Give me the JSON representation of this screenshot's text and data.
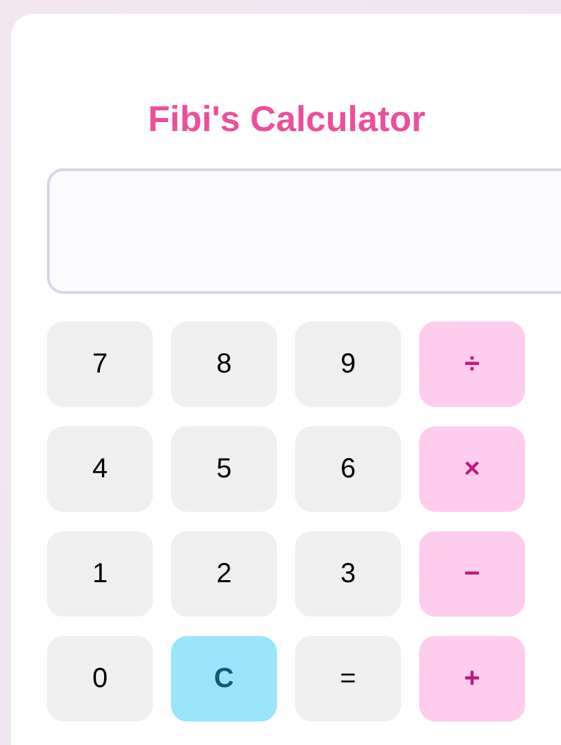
{
  "title": "Fibi's Calculator",
  "buttons": [
    {
      "label": "7",
      "kind": "digit"
    },
    {
      "label": "8",
      "kind": "digit"
    },
    {
      "label": "9",
      "kind": "digit"
    },
    {
      "label": "÷",
      "kind": "operator"
    },
    {
      "label": "4",
      "kind": "digit"
    },
    {
      "label": "5",
      "kind": "digit"
    },
    {
      "label": "6",
      "kind": "digit"
    },
    {
      "label": "×",
      "kind": "operator"
    },
    {
      "label": "1",
      "kind": "digit"
    },
    {
      "label": "2",
      "kind": "digit"
    },
    {
      "label": "3",
      "kind": "digit"
    },
    {
      "label": "−",
      "kind": "operator"
    },
    {
      "label": "0",
      "kind": "digit"
    },
    {
      "label": "C",
      "kind": "clear"
    },
    {
      "label": "=",
      "kind": "equals"
    },
    {
      "label": "+",
      "kind": "operator"
    }
  ]
}
